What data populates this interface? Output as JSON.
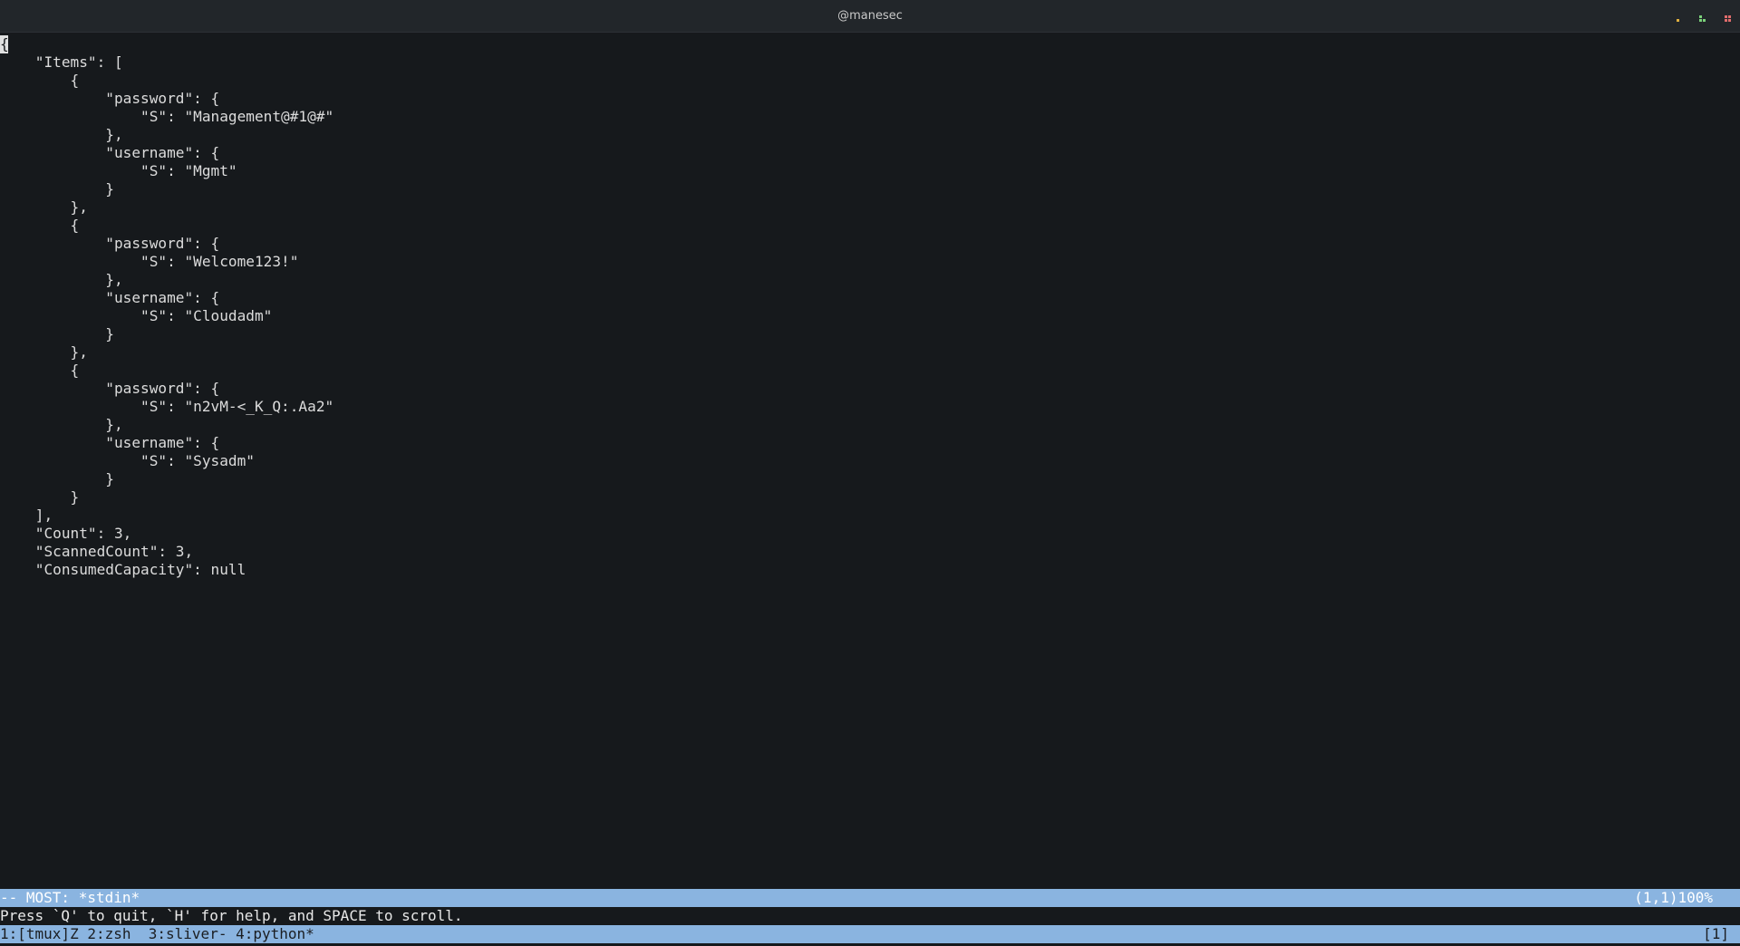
{
  "window": {
    "title": "@manesec",
    "controls": [
      {
        "name": "minimize",
        "color": "#e0b040"
      },
      {
        "name": "maximize",
        "color": "#7ad07a"
      },
      {
        "name": "close",
        "color": "#e06c6c"
      }
    ]
  },
  "terminal": {
    "cursor_char": "{",
    "lines": [
      "{",
      "    \"Items\": [",
      "        {",
      "            \"password\": {",
      "                \"S\": \"Management@#1@#\"",
      "            },",
      "            \"username\": {",
      "                \"S\": \"Mgmt\"",
      "            }",
      "        },",
      "        {",
      "            \"password\": {",
      "                \"S\": \"Welcome123!\"",
      "            },",
      "            \"username\": {",
      "                \"S\": \"Cloudadm\"",
      "            }",
      "        },",
      "        {",
      "            \"password\": {",
      "                \"S\": \"n2vM-<_K_Q:.Aa2\"",
      "            },",
      "            \"username\": {",
      "                \"S\": \"Sysadm\"",
      "            }",
      "        }",
      "    ],",
      "    \"Count\": 3,",
      "    \"ScannedCount\": 3,",
      "    \"ConsumedCapacity\": null",
      "}"
    ]
  },
  "pager": {
    "status_left": "-- MOST: *stdin*",
    "status_right": "(1,1)100%",
    "prompt": "Press `Q' to quit, `H' for help, and SPACE to scroll."
  },
  "tmux": {
    "windows": "1:[tmux]Z 2:zsh  3:sliver- 4:python*",
    "right": "[1]"
  },
  "colors": {
    "background": "#16191c",
    "titlebar": "#22262a",
    "statusbar": "#8ab4e0",
    "text": "#dcdcdc"
  }
}
